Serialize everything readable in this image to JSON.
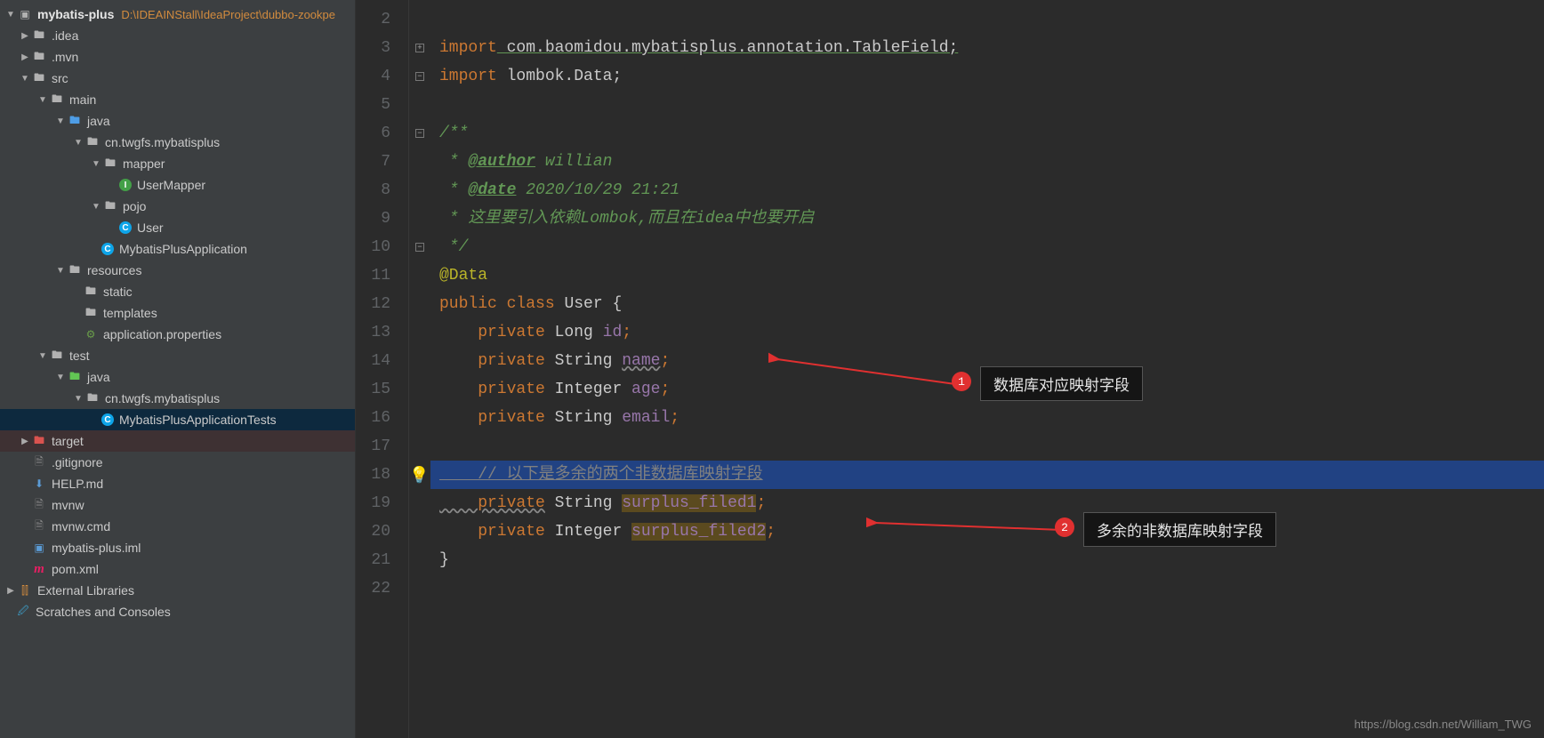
{
  "project": {
    "name": "mybatis-plus",
    "path": "D:\\IDEAINStall\\IdeaProject\\dubbo-zookpe"
  },
  "tree": {
    "idea": ".idea",
    "mvn": ".mvn",
    "src": "src",
    "main": "main",
    "java": "java",
    "pkg": "cn.twgfs.mybatisplus",
    "mapper": "mapper",
    "userMapper": "UserMapper",
    "pojo": "pojo",
    "user": "User",
    "app": "MybatisPlusApplication",
    "resources": "resources",
    "static": "static",
    "templates": "templates",
    "appprops": "application.properties",
    "test": "test",
    "testjava": "java",
    "testpkg": "cn.twgfs.mybatisplus",
    "testclass": "MybatisPlusApplicationTests",
    "target": "target",
    "gitignore": ".gitignore",
    "help": "HELP.md",
    "mvnw": "mvnw",
    "mvnwcmd": "mvnw.cmd",
    "iml": "mybatis-plus.iml",
    "pom": "pom.xml",
    "extlib": "External Libraries",
    "scratch": "Scratches and Consoles"
  },
  "editor": {
    "lines": [
      2,
      3,
      4,
      5,
      6,
      7,
      8,
      9,
      10,
      11,
      12,
      13,
      14,
      15,
      16,
      17,
      18,
      19,
      20,
      21,
      22
    ]
  },
  "code": {
    "import1_kw": "import",
    "import1_rest": " com.baomidou.mybatisplus.annotation.TableField;",
    "import2_kw": "import",
    "import2_rest": " lombok.Data;",
    "doc_open": "/**",
    "doc_author_pre": " * ",
    "doc_author_tag": "@author",
    "doc_author_val": " willian",
    "doc_date_pre": " * ",
    "doc_date_tag": "@date",
    "doc_date_val": " 2020/10/29 21:21",
    "doc_note": " * 这里要引入依赖Lombok,而且在idea中也要开启",
    "doc_close": " */",
    "anno_data": "@Data",
    "cls_public": "public ",
    "cls_class": "class",
    "cls_name": " User {",
    "f1_private": "    private",
    "f1_type": " Long ",
    "f1_name": "id",
    "f2_private": "    private",
    "f2_type": " String ",
    "f2_name": "name",
    "f3_private": "    private",
    "f3_type": " Integer ",
    "f3_name": "age",
    "f4_private": "    private",
    "f4_type": " String ",
    "f4_name": "email",
    "comment_extra": "    // 以下是多余的两个非数据库映射字段",
    "f5_private": "    private",
    "f5_type": " String ",
    "f5_name": "surplus_filed1",
    "f6_private": "    private",
    "f6_type": " Integer ",
    "f6_name": "surplus_filed2",
    "close": "}",
    "semi": ";"
  },
  "annotations": {
    "a1_num": "1",
    "a1_text": "数据库对应映射字段",
    "a2_num": "2",
    "a2_text": "多余的非数据库映射字段"
  },
  "watermark": "https://blog.csdn.net/William_TWG"
}
